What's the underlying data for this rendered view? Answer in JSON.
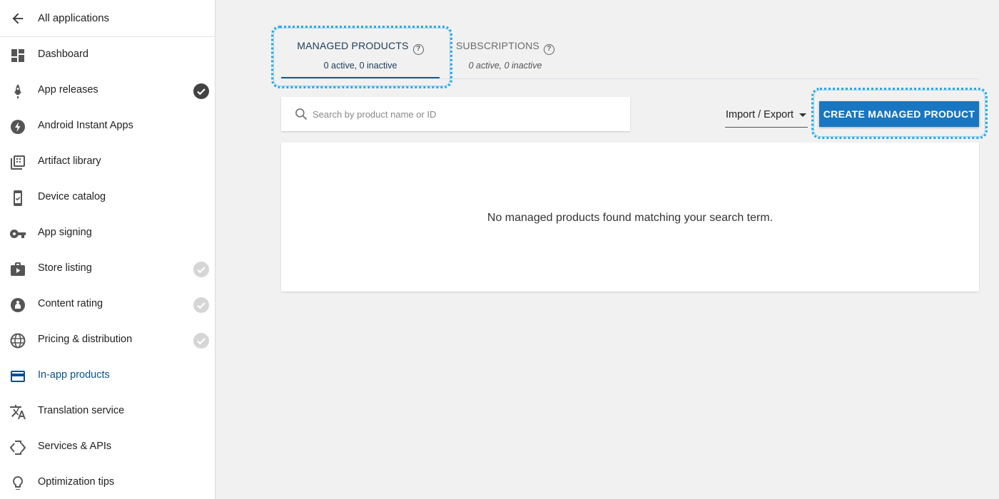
{
  "sidebar": {
    "back_label": "All applications",
    "items": [
      {
        "label": "Dashboard",
        "icon": "dashboard-icon",
        "status": "none"
      },
      {
        "label": "App releases",
        "icon": "rocket-icon",
        "status": "done"
      },
      {
        "label": "Android Instant Apps",
        "icon": "lightning-icon",
        "status": "none"
      },
      {
        "label": "Artifact library",
        "icon": "library-icon",
        "status": "none"
      },
      {
        "label": "Device catalog",
        "icon": "device-icon",
        "status": "none"
      },
      {
        "label": "App signing",
        "icon": "key-icon",
        "status": "none"
      },
      {
        "label": "Store listing",
        "icon": "store-icon",
        "status": "pending"
      },
      {
        "label": "Content rating",
        "icon": "rating-icon",
        "status": "pending"
      },
      {
        "label": "Pricing & distribution",
        "icon": "globe-icon",
        "status": "pending"
      },
      {
        "label": "In-app products",
        "icon": "card-icon",
        "status": "active"
      },
      {
        "label": "Translation service",
        "icon": "translate-icon",
        "status": "none"
      },
      {
        "label": "Services & APIs",
        "icon": "api-icon",
        "status": "none"
      },
      {
        "label": "Optimization tips",
        "icon": "lightbulb-icon",
        "status": "none"
      }
    ]
  },
  "tabs": {
    "managed": {
      "title": "MANAGED PRODUCTS",
      "sub": "0 active, 0 inactive"
    },
    "subscriptions": {
      "title": "SUBSCRIPTIONS",
      "sub": "0 active, 0 inactive"
    }
  },
  "search": {
    "placeholder": "Search by product name or ID",
    "value": ""
  },
  "toolbar": {
    "import_export_label": "Import / Export",
    "create_label": "CREATE MANAGED PRODUCT"
  },
  "main": {
    "empty_message": "No managed products found matching your search term."
  },
  "colors": {
    "accent": "#1976c0",
    "highlight": "#29a8e6",
    "active_nav": "#0b4f8a"
  }
}
